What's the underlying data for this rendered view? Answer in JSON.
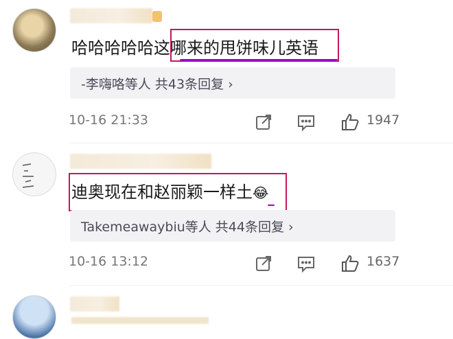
{
  "comments": [
    {
      "text_plain": "哈哈哈哈哈这",
      "text_highlight": "哪来的甩饼味儿英语",
      "replies_summary": "-李嗨咯等人  共43条回复 ›",
      "time": "10-16 21:33",
      "likes": "1947"
    },
    {
      "text_highlight": "迪奥现在和赵丽颖一样土",
      "emoji": "😂",
      "replies_summary": "Takemeawaybiu等人  共44条回复 ›",
      "time": "10-16 13:12",
      "likes": "1637"
    }
  ],
  "icons": {
    "share": "share-icon",
    "comment": "comment-icon",
    "like": "like-icon"
  },
  "colors": {
    "highlight_border": "#c2185b",
    "underline": "#a000c8"
  }
}
